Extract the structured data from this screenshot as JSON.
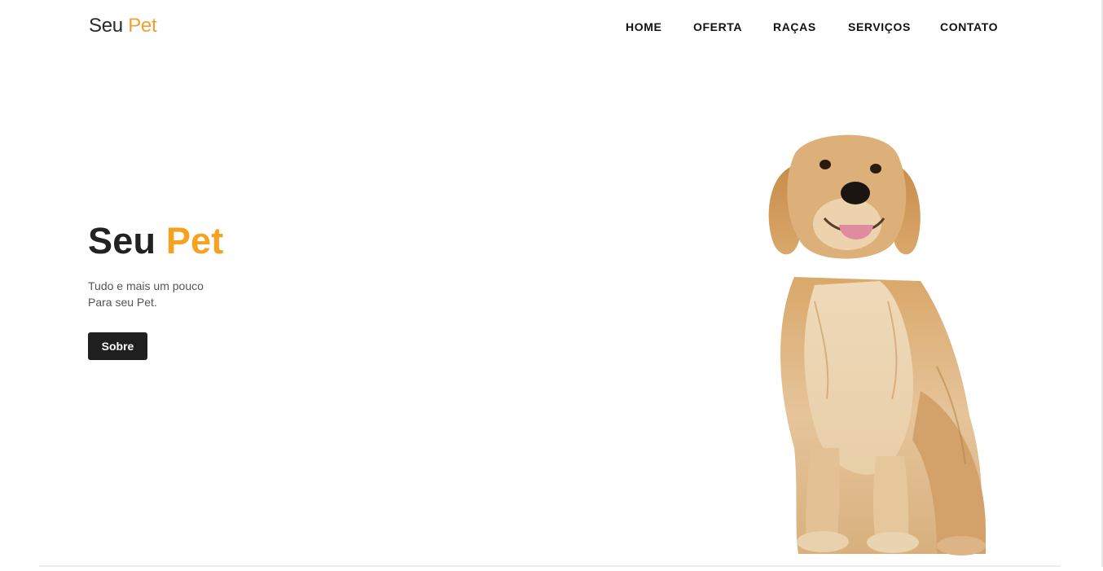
{
  "header": {
    "logo": {
      "part1": "Seu",
      "part2": "Pet"
    },
    "nav": [
      {
        "label": "HOME"
      },
      {
        "label": "OFERTA"
      },
      {
        "label": "RAÇAS"
      },
      {
        "label": "SERVIÇOS"
      },
      {
        "label": "CONTATO"
      }
    ]
  },
  "hero": {
    "title_part1": "Seu",
    "title_part2": "Pet",
    "line1": "Tudo e mais um pouco",
    "line2": "Para seu Pet.",
    "button_label": "Sobre"
  },
  "colors": {
    "accent": "#f6a21e",
    "logo_accent": "#f0a030",
    "text_dark": "#222222",
    "button_bg": "#1f1f1f"
  },
  "image": {
    "icon": "golden-retriever-photo"
  }
}
